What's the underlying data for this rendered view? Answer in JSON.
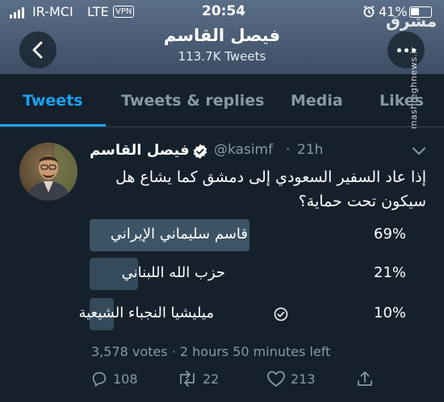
{
  "status_bar": {
    "carrier": "IR-MCI",
    "network": "LTE",
    "vpn": "VPN",
    "time": "20:54",
    "battery": "41%"
  },
  "profile": {
    "name": "فيصل القاسم",
    "tweet_count": "113.7K Tweets"
  },
  "watermark": {
    "logo": "مشرق",
    "url": "mashreghnews.ir"
  },
  "tabs": [
    {
      "label": "Tweets",
      "active": true
    },
    {
      "label": "Tweets & replies",
      "active": false
    },
    {
      "label": "Media",
      "active": false
    },
    {
      "label": "Likes",
      "active": false
    }
  ],
  "tweet": {
    "author_name": "فيصل القاسم",
    "handle": "@kasimf",
    "separator": "·",
    "time": "21h",
    "text": "إذا عاد السفير السعودي إلى دمشق كما يشاع هل سيكون تحت حماية؟",
    "poll": {
      "options": [
        {
          "label": "قاسم سليماني الإيراني",
          "percent": "69%",
          "value": 69,
          "selected": false
        },
        {
          "label": "حزب الله اللبناني",
          "percent": "21%",
          "value": 21,
          "selected": false
        },
        {
          "label": "ميليشيا النجباء الشيعية",
          "percent": "10%",
          "value": 10,
          "selected": true
        }
      ],
      "votes": "3,578 votes",
      "time_left": "2 hours 50 minutes left",
      "meta_separator": " · "
    },
    "actions": {
      "replies": "108",
      "retweets": "22",
      "likes": "213"
    }
  },
  "colors": {
    "background": "#15202b",
    "accent": "#1da1f2",
    "muted": "#8899a6",
    "poll_bar": "#3d5466"
  }
}
